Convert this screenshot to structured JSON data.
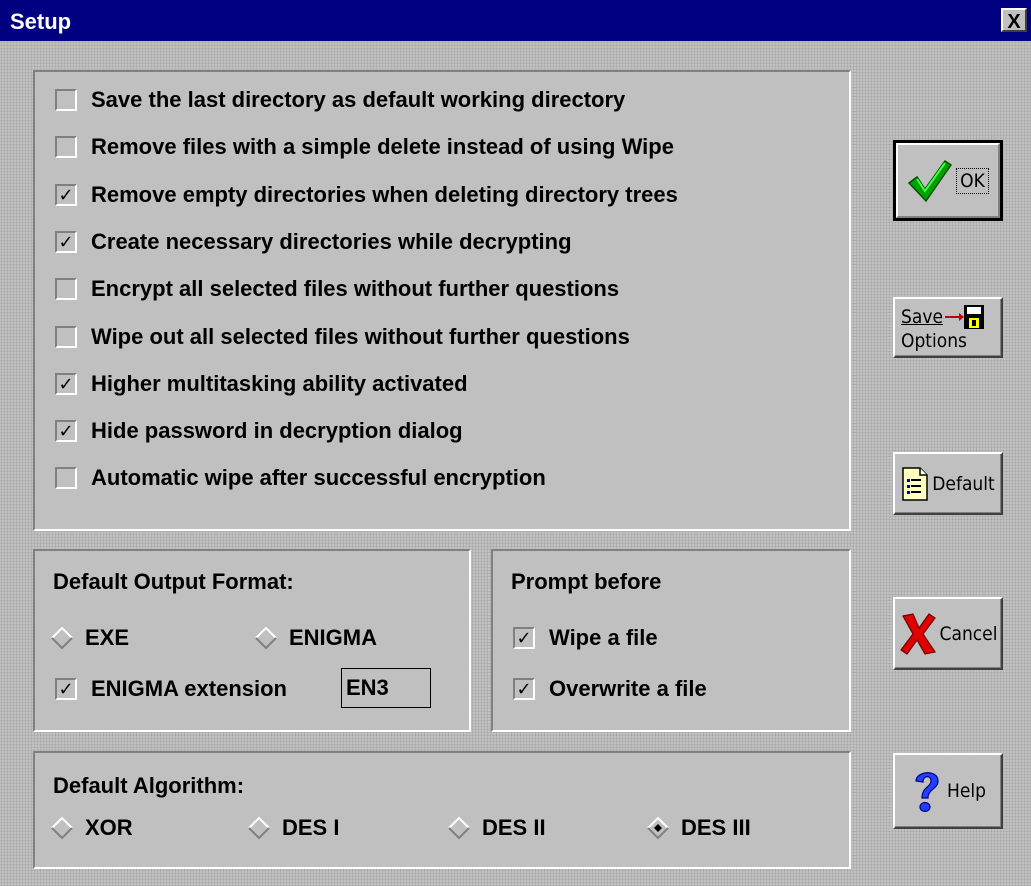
{
  "window": {
    "title": "Setup",
    "close_label": "X"
  },
  "options": [
    {
      "label": "Save the last directory as default working directory",
      "checked": false
    },
    {
      "label": "Remove files with a simple delete instead of using Wipe",
      "checked": false
    },
    {
      "label": "Remove empty directories when deleting directory trees",
      "checked": true
    },
    {
      "label": "Create necessary directories while decrypting",
      "checked": true
    },
    {
      "label": "Encrypt all selected files without further questions",
      "checked": false
    },
    {
      "label": "Wipe out all selected files without further questions",
      "checked": false
    },
    {
      "label": "Higher multitasking ability activated",
      "checked": true
    },
    {
      "label": "Hide password in decryption dialog",
      "checked": true
    },
    {
      "label": "Automatic wipe after successful encryption",
      "checked": false
    }
  ],
  "output_format": {
    "heading": "Default Output Format:",
    "exe_label": "EXE",
    "exe_selected": false,
    "enigma_label": "ENIGMA",
    "enigma_selected": false,
    "extension_label": "ENIGMA extension",
    "extension_checked": true,
    "extension_value": "EN3"
  },
  "prompt_before": {
    "heading": "Prompt before",
    "wipe_label": "Wipe a file",
    "wipe_checked": true,
    "overwrite_label": "Overwrite a file",
    "overwrite_checked": true
  },
  "algorithm": {
    "heading": "Default Algorithm:",
    "options": [
      {
        "label": "XOR",
        "selected": false
      },
      {
        "label": "DES I",
        "selected": false
      },
      {
        "label": "DES II",
        "selected": false
      },
      {
        "label": "DES III",
        "selected": true
      }
    ]
  },
  "buttons": {
    "ok": "OK",
    "save_line1": "Save",
    "save_line2": "Options",
    "default": "Default",
    "cancel": "Cancel",
    "help": "Help"
  },
  "check_mark": "✓"
}
